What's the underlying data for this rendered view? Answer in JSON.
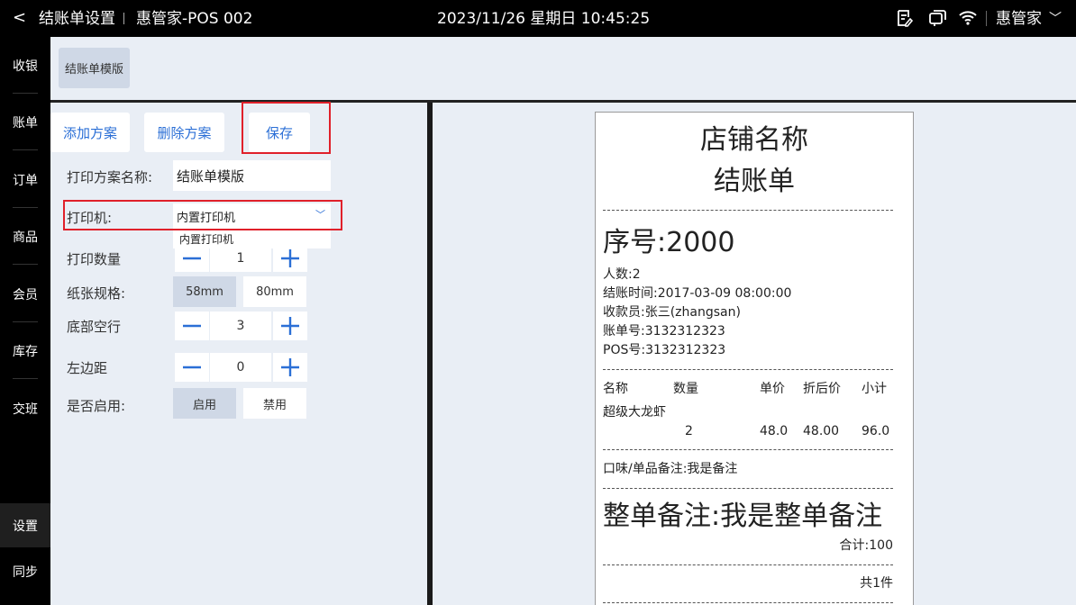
{
  "topbar": {
    "back": "<",
    "title": "结账单设置",
    "store": "惠管家-POS 002",
    "datetime": "2023/11/26 星期日 10:45:25",
    "user": "惠管家",
    "icons": [
      "note-icon",
      "window-icon",
      "wifi-icon"
    ]
  },
  "sidebar": {
    "items": [
      {
        "label": "收银"
      },
      {
        "label": "账单"
      },
      {
        "label": "订单"
      },
      {
        "label": "商品"
      },
      {
        "label": "会员"
      },
      {
        "label": "库存"
      },
      {
        "label": "交班"
      },
      {
        "label": "设置",
        "active": true
      },
      {
        "label": "同步"
      }
    ]
  },
  "tabs": {
    "template": "结账单模版"
  },
  "toolbar": {
    "add": "添加方案",
    "delete": "删除方案",
    "save": "保存"
  },
  "form": {
    "name_label": "打印方案名称:",
    "name_value": "结账单模版",
    "printer_label": "打印机:",
    "printer_value": "内置打印机",
    "printer_option": "内置打印机",
    "copies_label": "打印数量",
    "copies_value": "1",
    "paper_label": "纸张规格:",
    "paper_options": [
      "58mm",
      "80mm"
    ],
    "paper_selected": "58mm",
    "bottom_label": "底部空行",
    "bottom_value": "3",
    "margin_label": "左边距",
    "margin_value": "0",
    "enable_label": "是否启用:",
    "enable_options": [
      "启用",
      "禁用"
    ],
    "enable_selected": "启用"
  },
  "receipt": {
    "shop": "店铺名称",
    "doc": "结账单",
    "seq": "序号:2000",
    "people": "人数:2",
    "time": "结账时间:2017-03-09 08:00:00",
    "cashier": "收款员:张三(zhangsan)",
    "bill_no": "账单号:3132312323",
    "pos_no": "POS号:3132312323",
    "headers": [
      "名称",
      "数量",
      "单价",
      "折后价",
      "小计"
    ],
    "item_name": "超级大龙虾",
    "item_qty": "2",
    "item_price": "48.0",
    "item_discount": "48.00",
    "item_subtotal": "96.0",
    "item_note": "口味/单品备注:我是备注",
    "order_note": "整单备注:我是整单备注",
    "total": "合计:100",
    "count": "共1件"
  },
  "colors": {
    "accent": "#2b6fd6",
    "highlight": "#e0202a",
    "panel": "#e9eef5",
    "selected": "#cfd8e6"
  }
}
